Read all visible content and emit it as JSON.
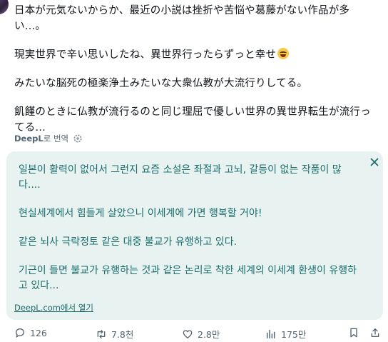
{
  "post": {
    "paragraphs": [
      "日本が元気ないからか、最近の小説は挫折や苦悩や葛藤がない作品が多い…。",
      "現実世界で辛い思いしたね、異世界行ったらずっと幸せ",
      "みたいな脳死の極楽浄土みたいな大衆仏教が大流行りしてる。",
      "飢饉のときに仏教が流行るのと同じ理屈で優しい世界の異世界転生が流行ってる…"
    ],
    "emoji_icon": "grinning-squinting-face-emoji"
  },
  "translation": {
    "prefix": "DeepL",
    "suffix": "로 번역",
    "paragraphs": [
      "일본이 활력이 없어서 그런지 요즘 소설은 좌절과 고뇌, 갈등이 없는 작품이 많다....",
      "현실세계에서 힘들게 살았으니 이세계에 가면 행복할 거야!",
      "같은 뇌사 극락정토 같은 대중 불교가 유행하고 있다.",
      "기근이 들면 불교가 유행하는 것과 같은 논리로 착한 세계의 이세계 환생이 유행하고 있다..."
    ],
    "open_link": "DeepL.com에서 열기",
    "box_color": "#e7f2f1",
    "text_color": "#1a6e6b"
  },
  "actions": {
    "replies": "126",
    "reposts": "7.8천",
    "likes": "2.8만",
    "views": "175만"
  }
}
